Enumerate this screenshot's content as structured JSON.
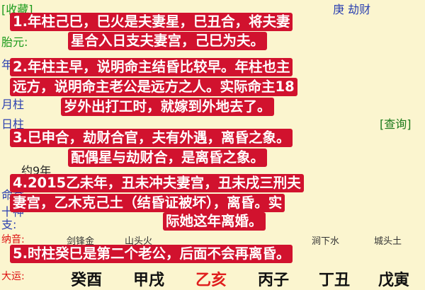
{
  "background": {
    "header_left": "[收藏]",
    "header_right": "庚 劫财",
    "row_taiyuan": "胎元:",
    "row_year": "年柱",
    "row_month": "月柱",
    "row_day": "日柱",
    "query_link": "[查询]",
    "row_age": "约9年",
    "row_ming": "命宫",
    "row_god": "十神",
    "row_dizhi": "支:",
    "row_nayin_label": "纳音:",
    "row_dayun_label": "大运:",
    "nayin": [
      "剑锋金",
      "山头火",
      "",
      "涧下水",
      "城头土"
    ],
    "dayun": [
      "癸酉",
      "甲戌",
      "乙亥",
      "丙子",
      "丁丑",
      "戊寅"
    ]
  },
  "overlay": {
    "p1_l1": "1.年柱己巳，巳火是夫妻星，巳丑合，将夫妻",
    "p1_l2": "星合入日支夫妻宫，己巳为夫。",
    "p2_l1": "2.年柱主早，说明命主结昏比较早。年柱也主",
    "p2_l2": "远方，说明命主老公是远方之人。实际命主18",
    "p2_l3": "岁外出打工时，就嫁到外地去了。",
    "p3_l1": "3.巳申合，劫财合官，夫有外遇，离昏之象。",
    "p3_l2": "配偶星与劫财合，是离昏之象。",
    "p4_l1": "4.2015乙未年，丑未冲夫妻宫，丑未戌三刑夫",
    "p4_l2": "妻宫，乙木克己土（结昏证被坏），离昏。实",
    "p4_l3": "际她这年离婚。",
    "p5_l1": "5.时柱癸巳是第二个老公，后面不会再离昏。"
  },
  "colors": {
    "banner": "#d1122e",
    "background": "#fbf5cf",
    "highlight": "#e01e1e"
  }
}
